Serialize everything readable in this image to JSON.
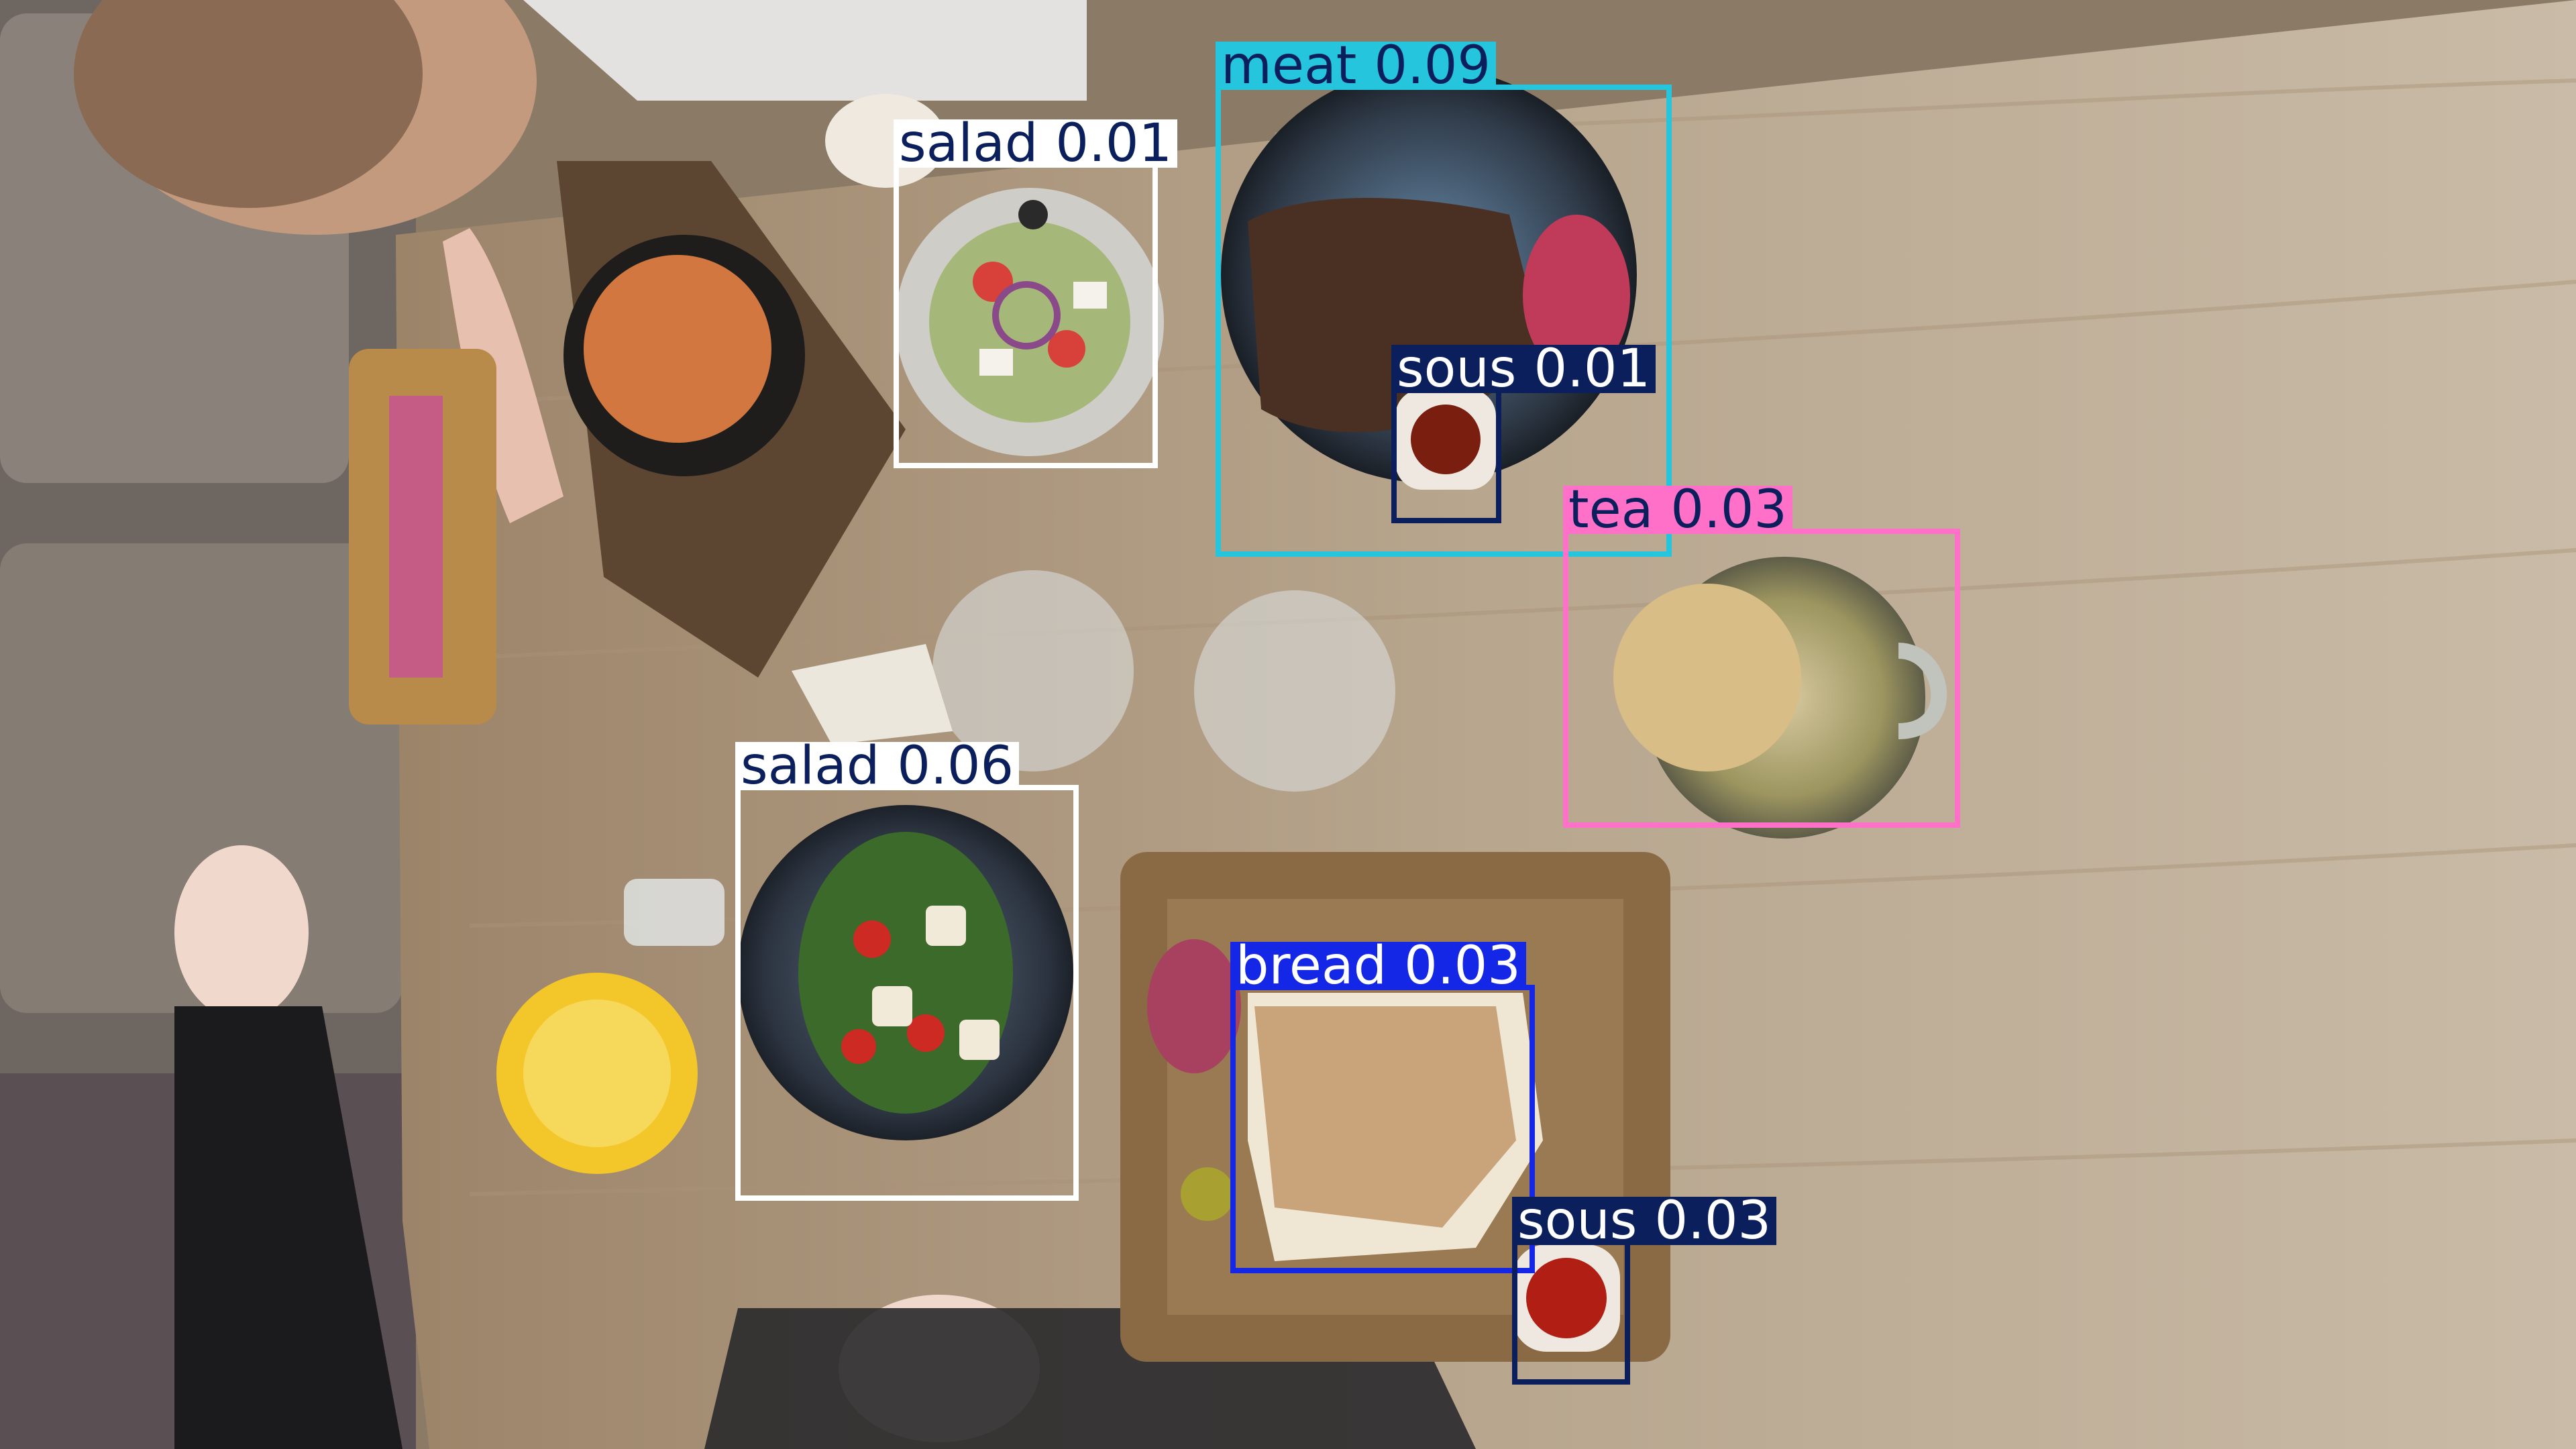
{
  "detections": [
    {
      "label": "meat",
      "score": "0.09",
      "color": "#25C5DD",
      "text_color": "#0A1F5C"
    },
    {
      "label": "salad",
      "score": "0.01",
      "color": "#FFFFFF",
      "text_color": "#0A1F5C"
    },
    {
      "label": "sous",
      "score": "0.01",
      "color": "#0A1F5C",
      "text_color": "#FFFFFF"
    },
    {
      "label": "tea",
      "score": "0.03",
      "color": "#FF70C8",
      "text_color": "#0A1F5C"
    },
    {
      "label": "salad",
      "score": "0.06",
      "color": "#FFFFFF",
      "text_color": "#0A1F5C"
    },
    {
      "label": "bread",
      "score": "0.03",
      "color": "#1427E6",
      "text_color": "#FFFFFF"
    },
    {
      "label": "sous",
      "score": "0.03",
      "color": "#0A1F5C",
      "text_color": "#FFFFFF"
    }
  ]
}
